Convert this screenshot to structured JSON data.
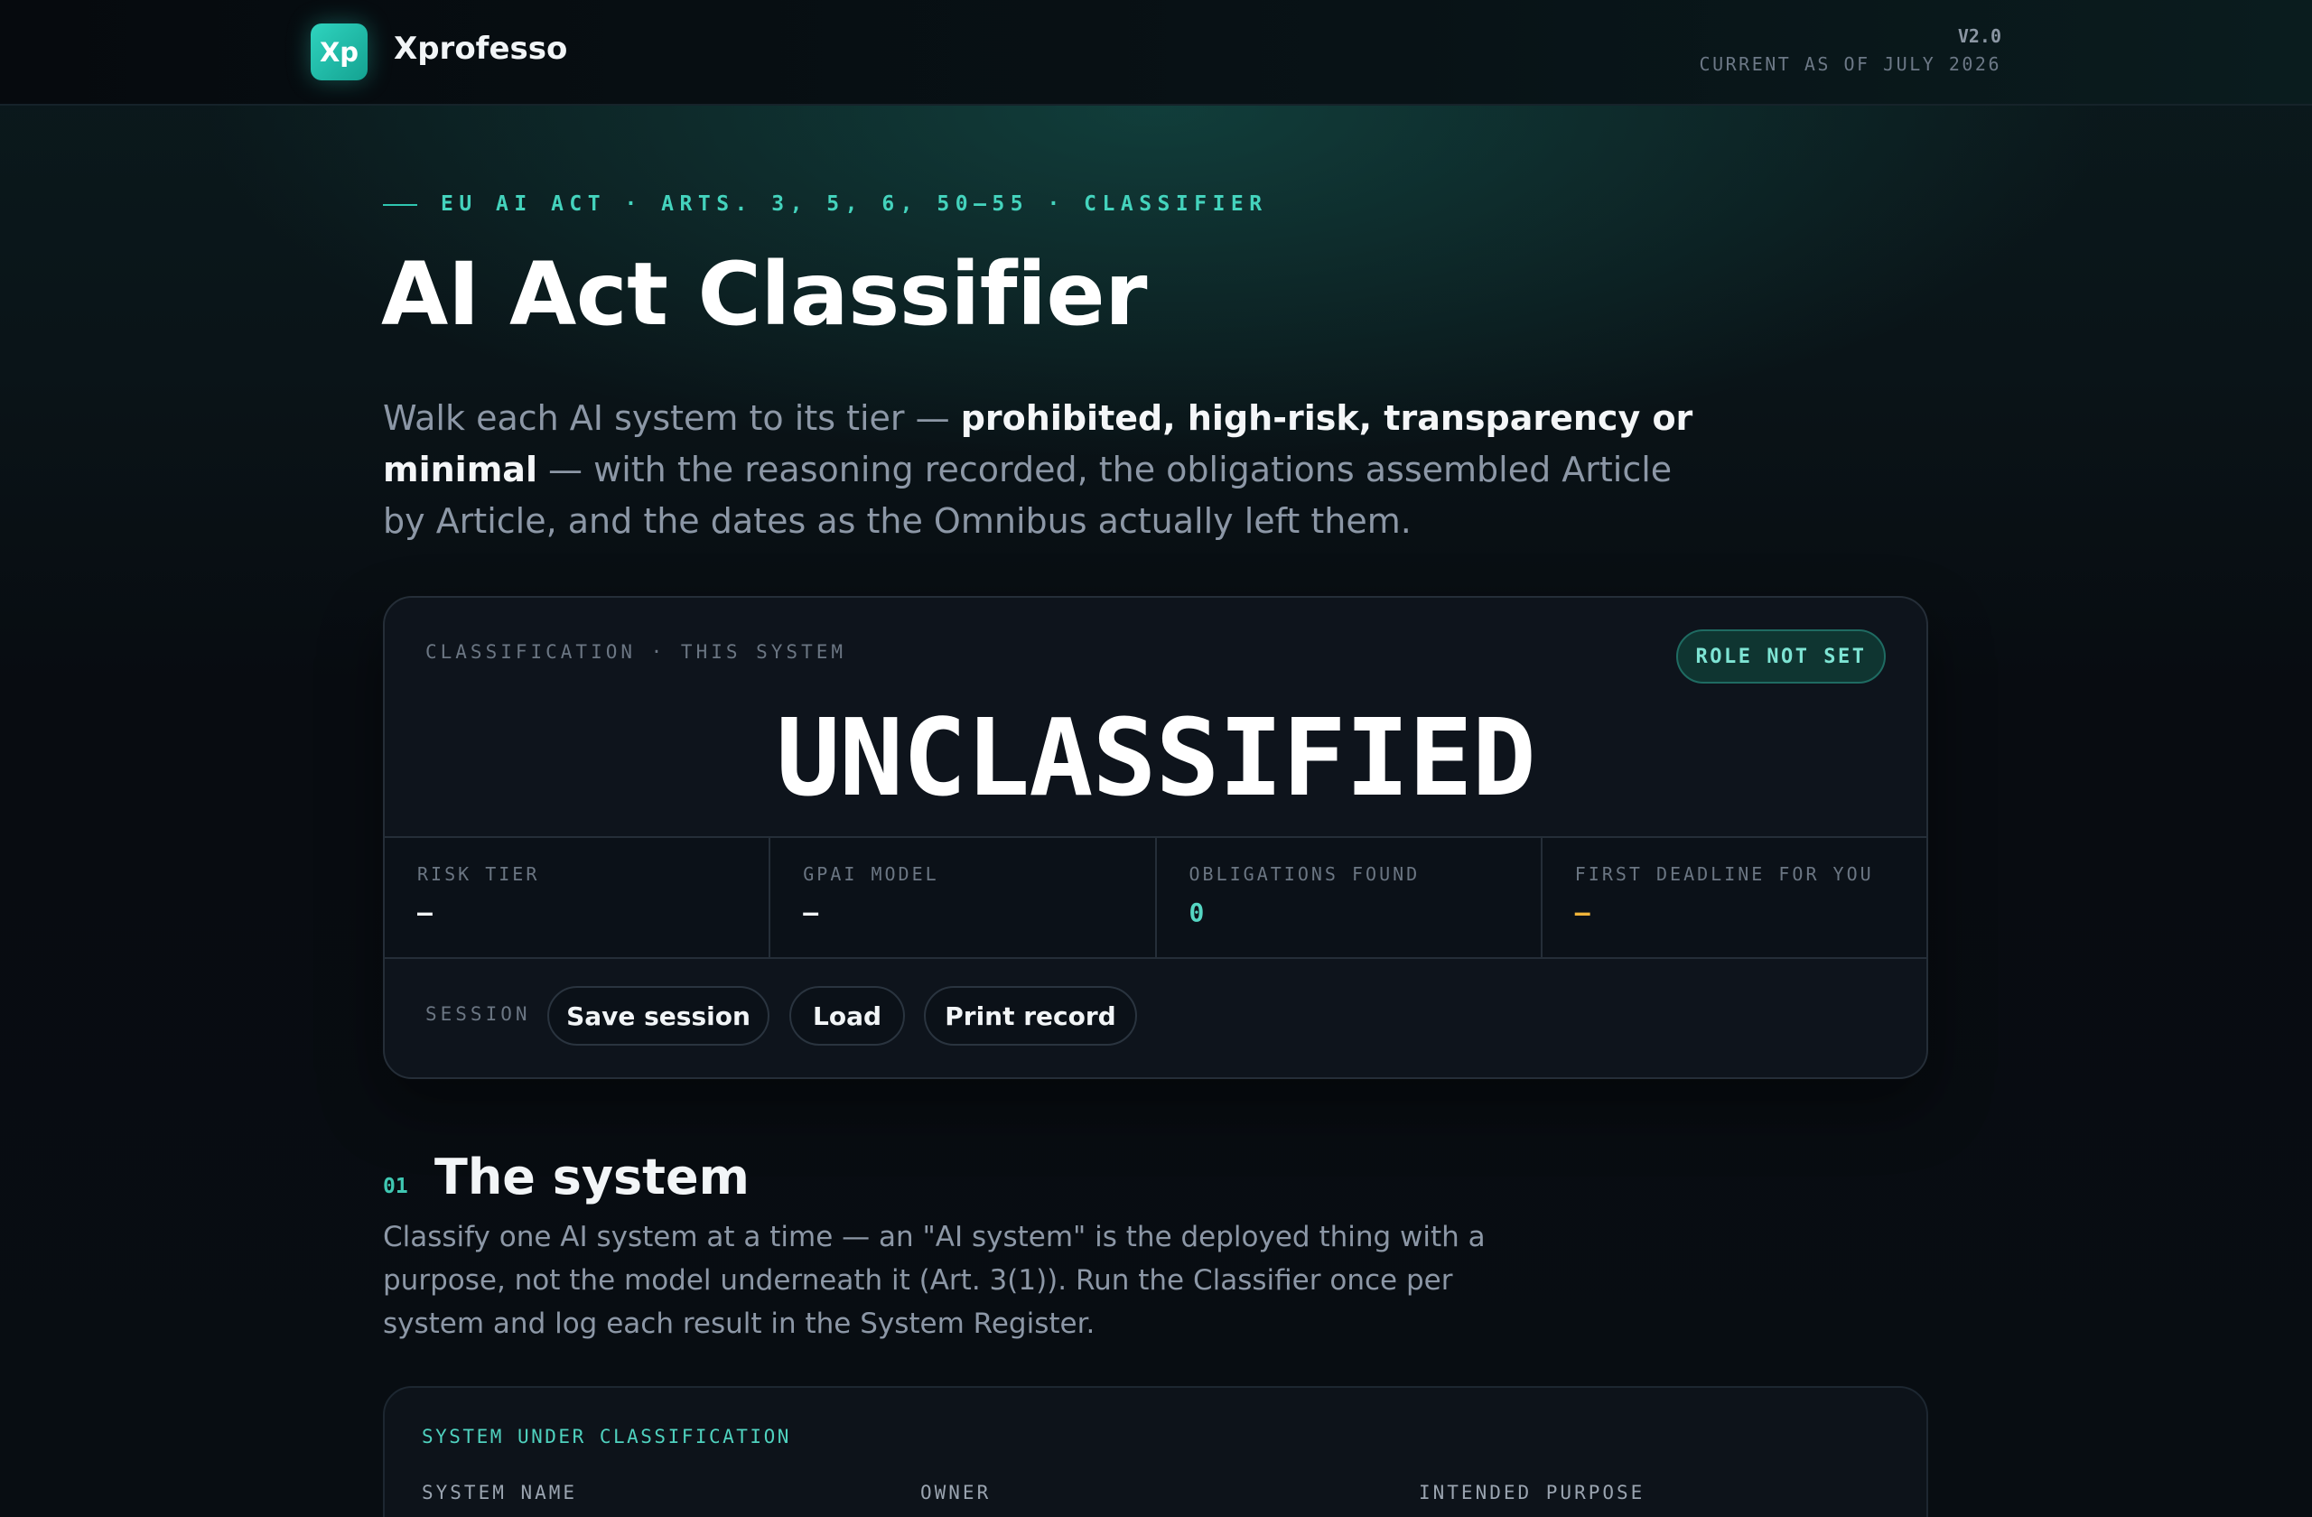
{
  "brand": {
    "logo_text": "Xp",
    "name": "Xprofesso",
    "version": "V2.0",
    "current_as_of": "CURRENT AS OF JULY 2026",
    "accent_color": "#2fd4bf"
  },
  "hero": {
    "eyebrow": "EU AI ACT · ARTS. 3, 5, 6, 50–55 · CLASSIFIER",
    "title": "AI Act Classifier",
    "lede_part1": "Walk each AI system to its tier — ",
    "lede_bold": "prohibited, high-risk, transparency or minimal",
    "lede_part2": " — with the reasoning recorded, the obligations assembled Article by Article, and the dates as the Omnibus actually left them."
  },
  "classification": {
    "kicker": "CLASSIFICATION · THIS SYSTEM",
    "role_badge": "ROLE NOT SET",
    "status": "UNCLASSIFIED",
    "stats": [
      {
        "label": "RISK TIER",
        "value": "–"
      },
      {
        "label": "GPAI MODEL",
        "value": "–"
      },
      {
        "label": "OBLIGATIONS FOUND",
        "value": "0"
      },
      {
        "label": "FIRST DEADLINE FOR YOU",
        "value": "–"
      }
    ],
    "session_label": "SESSION",
    "buttons": {
      "save": "Save session",
      "load": "Load",
      "print": "Print record"
    }
  },
  "section1": {
    "number": "01",
    "title": "The system",
    "body": "Classify one AI system at a time — an \"AI system\" is the deployed thing with a purpose, not the model underneath it (Art. 3(1)). Run the Classifier once per system and log each result in the System Register."
  },
  "system_card": {
    "kicker": "SYSTEM UNDER CLASSIFICATION",
    "fields": {
      "name": "SYSTEM NAME",
      "owner": "OWNER",
      "purpose": "INTENDED PURPOSE"
    }
  }
}
